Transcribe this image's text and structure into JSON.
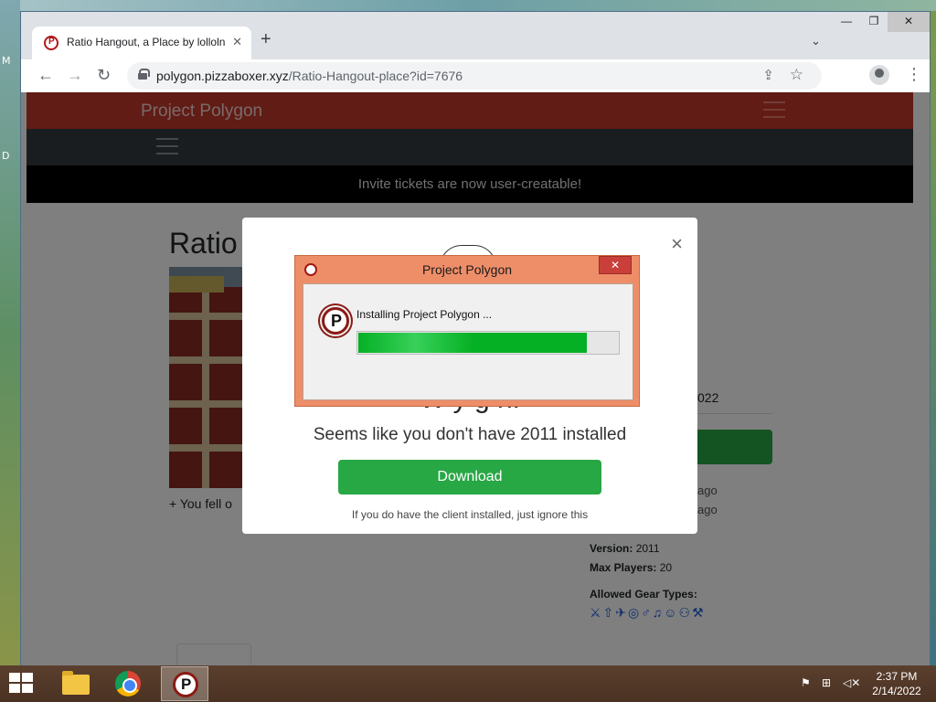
{
  "desktop": {
    "left_labels": [
      "M",
      "D"
    ]
  },
  "browser": {
    "tab_title": "Ratio Hangout, a Place by lolloln",
    "tab_close": "✕",
    "new_tab": "+",
    "tab_dropdown": "⌄",
    "win_minimize": "—",
    "win_maximize": "❐",
    "win_close": "✕",
    "back": "←",
    "forward": "→",
    "reload": "↻",
    "url_host": "polygon.pizzaboxer.xyz",
    "url_path": "/Ratio-Hangout-place?id=7676",
    "share": "⇪",
    "star": "☆",
    "menu": "⋮"
  },
  "site": {
    "brand": "Project Polygon",
    "announcement": "Invite tickets are now user-creatable!",
    "page_title": "Ratio",
    "description": "+ You fell o",
    "created_partial": "022",
    "updated_ago_1": "ago",
    "updated_ago_2": "ago",
    "version_label": "Version:",
    "version_value": "2011",
    "max_players_label": "Max Players:",
    "max_players_value": "20",
    "gear_types_label": "Allowed Gear Types:",
    "gear_icons": "⚔⇧✈◎♂♫☺⚇⚒"
  },
  "modal": {
    "close": "×",
    "heading": "W                     y                 g   n!",
    "subtitle": "Seems like you don't have 2011 installed",
    "download_label": "Download",
    "ignore_text": "If you do have the client installed, just ignore this"
  },
  "installer": {
    "title": "Project Polygon",
    "close": "✕",
    "message": "Installing Project Polygon ...",
    "progress": 0.88
  },
  "taskbar": {
    "time": "2:37 PM",
    "date": "2/14/2022",
    "tray_icons": [
      "flag-icon",
      "network-icon",
      "volume-icon"
    ]
  }
}
